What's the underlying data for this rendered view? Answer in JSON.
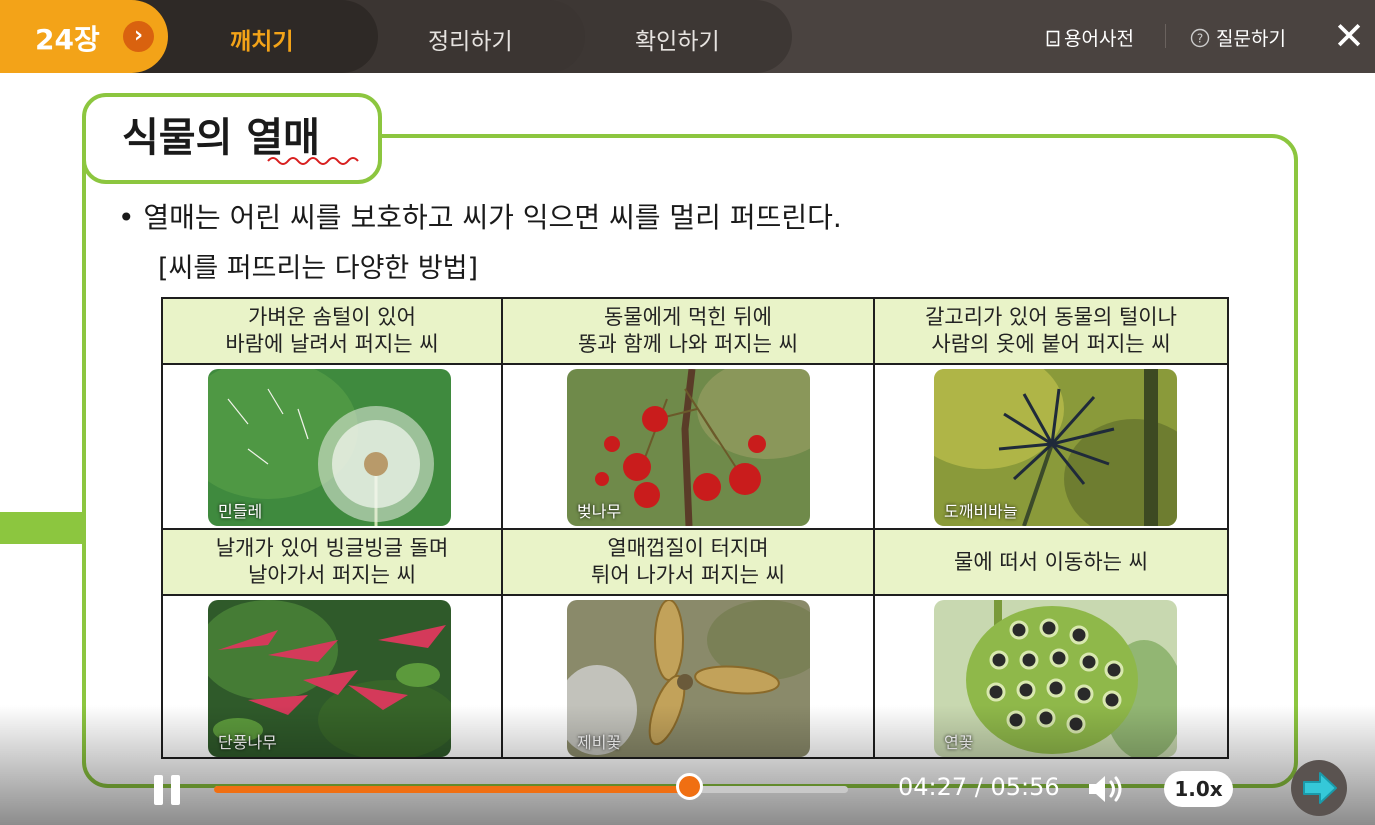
{
  "topbar": {
    "chapter": "24장",
    "tabs": [
      {
        "label": "깨치기",
        "active": true
      },
      {
        "label": "정리하기",
        "active": false
      },
      {
        "label": "확인하기",
        "active": false
      }
    ],
    "dictionary_label": "용어사전",
    "question_label": "질문하기",
    "close_icon": "✕"
  },
  "slide": {
    "title": "식물의 열매",
    "bullet": "•  열매는 어린 씨를 보호하고 씨가 익으면 씨를 멀리 퍼뜨린다.",
    "subheading": "[씨를 퍼뜨리는 다양한 방법]",
    "methods": [
      {
        "heading": "가벼운 솜털이 있어\n바람에 날려서 퍼지는 씨",
        "plant": "민들레"
      },
      {
        "heading": "동물에게 먹힌 뒤에\n똥과 함께 나와 퍼지는 씨",
        "plant": "벚나무"
      },
      {
        "heading": "갈고리가 있어 동물의 털이나\n사람의 옷에 붙어 퍼지는 씨",
        "plant": "도깨비바늘"
      },
      {
        "heading": "날개가 있어 빙글빙글 돌며\n날아가서 퍼지는 씨",
        "plant": "단풍나무"
      },
      {
        "heading": "열매껍질이 터지며\n튀어 나가서 퍼지는 씨",
        "plant": "제비꽃"
      },
      {
        "heading": "물에 떠서 이동하는 씨",
        "plant": "연꽃"
      }
    ]
  },
  "player": {
    "time": "04:27 / 05:56",
    "progress": 0.75,
    "speed": "1.0x"
  },
  "colors": {
    "accent_orange": "#f3a318",
    "progress_orange": "#f06f12",
    "frame_green": "#8cc63f",
    "header_green": "#e9f3c8",
    "topbar": "#4a4340"
  }
}
